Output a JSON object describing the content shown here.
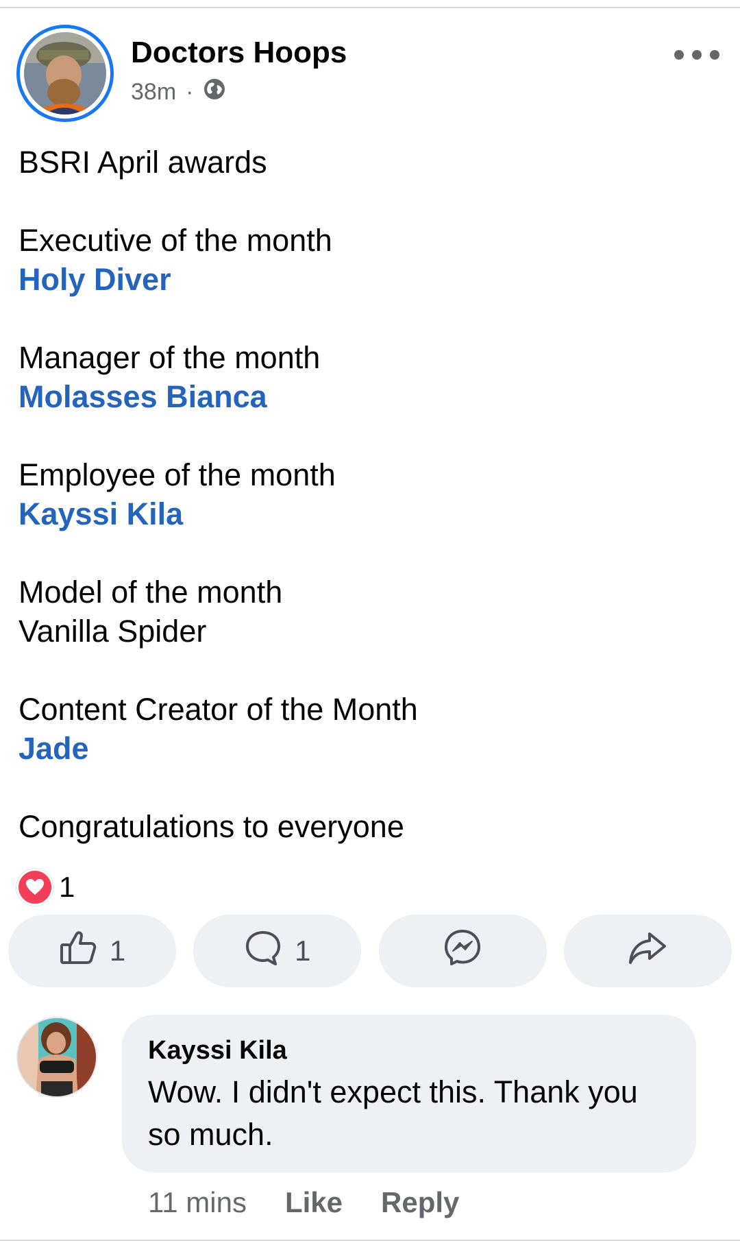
{
  "post": {
    "author": "Doctors Hoops",
    "time": "38m",
    "separator": "·",
    "privacy_icon": "globe-icon",
    "lines": [
      {
        "text": "BSRI April awards",
        "style": "plain"
      },
      {
        "text": "",
        "style": "gap"
      },
      {
        "text": "Executive of the month",
        "style": "plain"
      },
      {
        "text": "Holy Diver",
        "style": "link"
      },
      {
        "text": "",
        "style": "gap"
      },
      {
        "text": "Manager of the month",
        "style": "plain"
      },
      {
        "text": "Molasses Bianca",
        "style": "link"
      },
      {
        "text": "",
        "style": "gap"
      },
      {
        "text": "Employee of the month",
        "style": "plain"
      },
      {
        "text": "Kayssi Kila",
        "style": "link"
      },
      {
        "text": "",
        "style": "gap"
      },
      {
        "text": "Model of the month",
        "style": "plain"
      },
      {
        "text": "Vanilla Spider",
        "style": "plain"
      },
      {
        "text": "",
        "style": "gap"
      },
      {
        "text": "Content Creator of the Month",
        "style": "plain"
      },
      {
        "text": "Jade",
        "style": "link"
      },
      {
        "text": "",
        "style": "gap"
      },
      {
        "text": "Congratulations to everyone",
        "style": "plain"
      }
    ],
    "reaction_icon": "heart-icon",
    "reaction_count": "1"
  },
  "actions": {
    "like_count": "1",
    "comment_count": "1"
  },
  "comment": {
    "author": "Kayssi Kila",
    "text_line1": "Wow. I didn't expect this. Thank you",
    "text_line2": "so much.",
    "time": "11 mins",
    "like_label": "Like",
    "reply_label": "Reply"
  },
  "colors": {
    "link": "#2464bd",
    "ring": "#1877f2",
    "heart": "#f33e58",
    "pill": "#eef0f3"
  }
}
